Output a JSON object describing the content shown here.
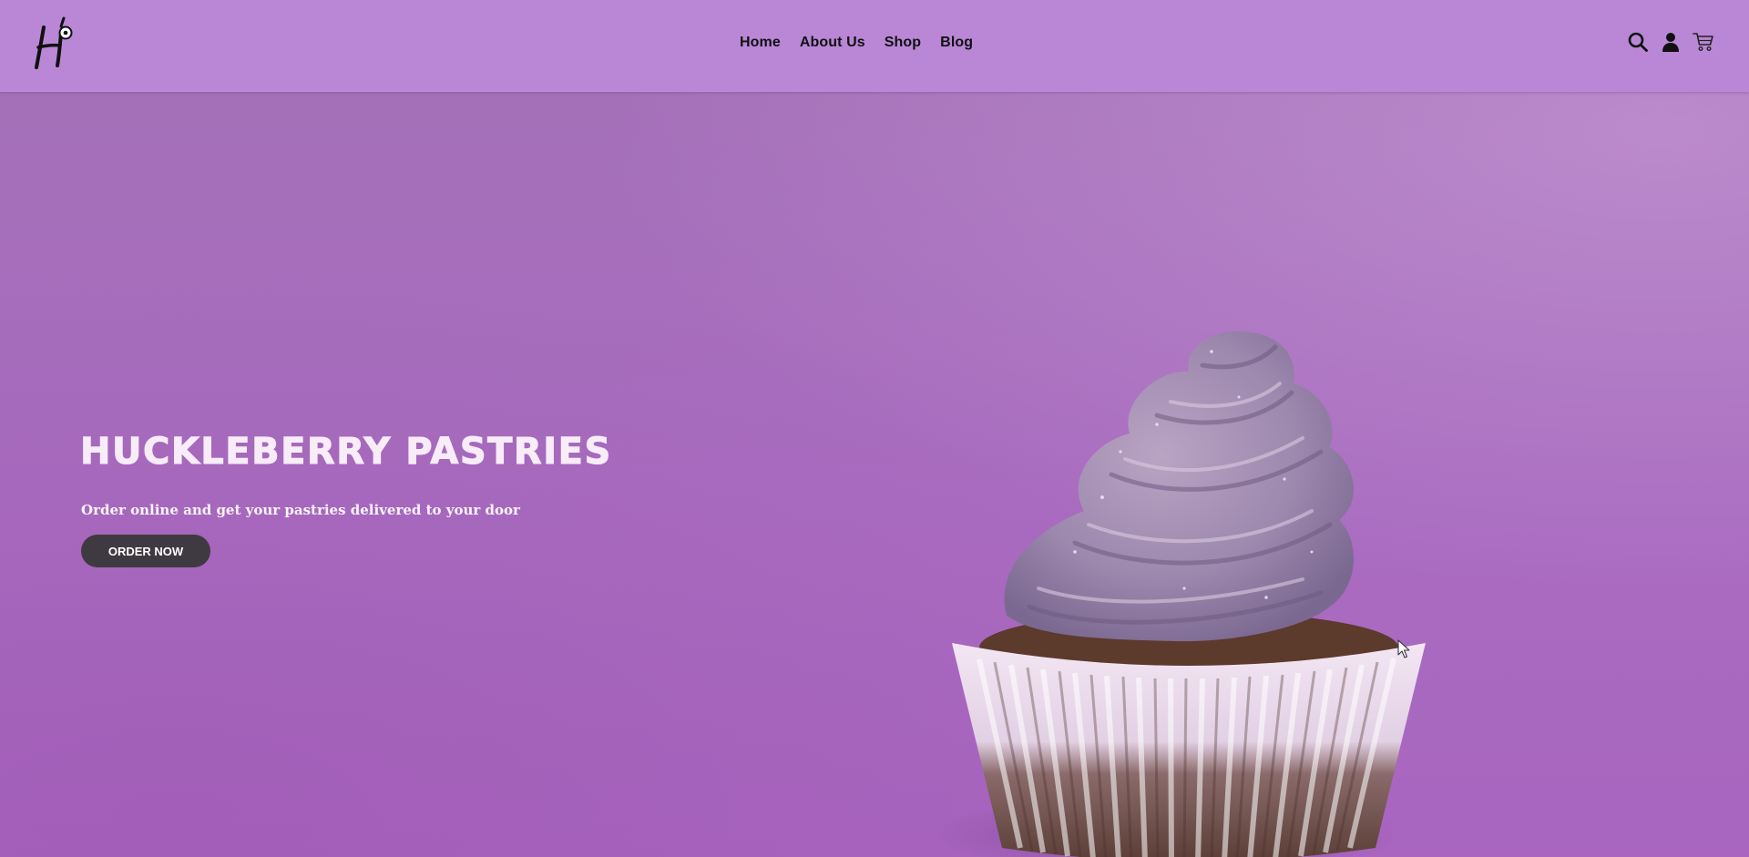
{
  "header": {
    "logo_name": "huckleberry-logo",
    "nav": [
      {
        "label": "Home"
      },
      {
        "label": "About Us"
      },
      {
        "label": "Shop"
      },
      {
        "label": "Blog"
      }
    ],
    "icons": [
      "search-icon",
      "account-icon",
      "cart-icon"
    ]
  },
  "hero": {
    "title": "Huckleberry Pastries",
    "subtitle": "Order online and get your pastries delivered to your door",
    "cta_label": "ORDER NOW"
  },
  "colors": {
    "header_bg": "#b987d6",
    "hero_bg": "#a46cb8",
    "title_color": "#f7ecf8",
    "button_bg": "#3f3a41",
    "button_text": "#ffffff"
  }
}
